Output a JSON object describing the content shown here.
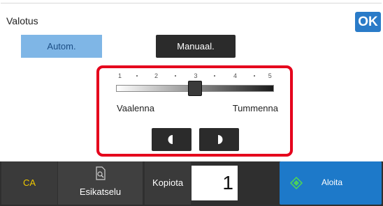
{
  "dialog": {
    "title": "Valotus",
    "ok_label": "OK"
  },
  "mode": {
    "auto_label": "Autom.",
    "manual_label": "Manuaal.",
    "selected": "Manuaal."
  },
  "slider": {
    "tick_labels": [
      "1",
      "2",
      "3",
      "4",
      "5"
    ],
    "value": 3,
    "min_label": "Vaalenna",
    "max_label": "Tummenna"
  },
  "bottom_bar": {
    "ca_label": "CA",
    "preview_label": "Esikatselu",
    "copies_label": "Kopiota",
    "copies_value": "1",
    "start_label": "Aloita"
  },
  "colors": {
    "accent": "#1d79c9",
    "highlight": "#e5001c",
    "ca_text": "#f0c800"
  }
}
